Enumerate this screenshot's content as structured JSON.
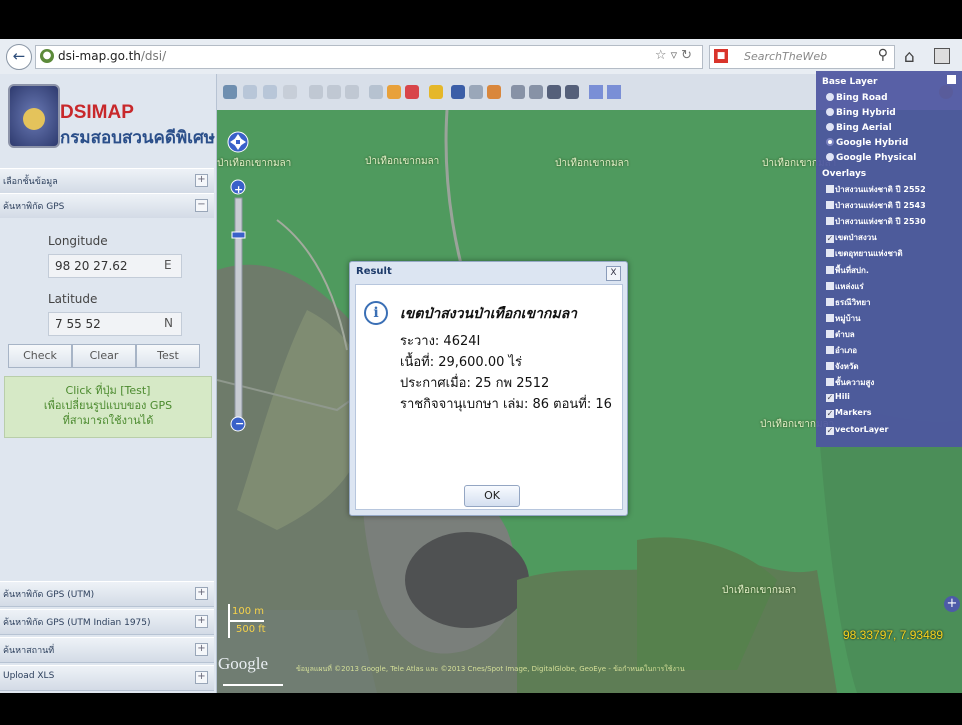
{
  "browser": {
    "url_domain": "dsi-map.go.th",
    "url_path": "/dsi/",
    "search_placeholder": "SearchTheWeb"
  },
  "app": {
    "logo_title": "DSIMAP",
    "logo_subtitle": "กรมสอบสวนคดีพิเศษ"
  },
  "sidebar": {
    "panels_top": [
      {
        "label": "เลือกชั้นข้อมูล",
        "toggle": "+"
      },
      {
        "label": "ค้นหาพิกัด GPS",
        "toggle": "−"
      }
    ],
    "gps": {
      "longitude_label": "Longitude",
      "longitude_value": "98 20 27.62",
      "longitude_unit": "E",
      "latitude_label": "Latitude",
      "latitude_value": "7 55 52",
      "latitude_unit": "N",
      "buttons": [
        "Check",
        "Clear",
        "Test"
      ],
      "hint_lines": [
        "Click ที่ปุ่ม [Test]",
        "เพื่อเปลี่ยนรูปแบบของ GPS",
        "ที่สามารถใช้งานได้"
      ]
    },
    "panels_bottom": [
      {
        "label": "ค้นหาพิกัด GPS (UTM)",
        "toggle": "+"
      },
      {
        "label": "ค้นหาพิกัด GPS (UTM Indian 1975)",
        "toggle": "+"
      },
      {
        "label": "ค้นหาสถานที่",
        "toggle": "+"
      },
      {
        "label": "Upload XLS",
        "toggle": "+"
      }
    ]
  },
  "map": {
    "labels": [
      {
        "text": "ป่าเทือกเขากมลา"
      },
      {
        "text": "ป่าเทือกเขากมลา"
      },
      {
        "text": "ป่าเทือกเขากมลา"
      },
      {
        "text": "ป่าเทือกเขากมลา"
      },
      {
        "text": "ป่าเทือกเขากมลา"
      },
      {
        "text": "ป่าเทือกเขากมลา"
      }
    ],
    "scale_m": "100 m",
    "scale_ft": "500 ft",
    "google": "Google",
    "copyright": "ข้อมูลแผนที่ ©2013 Google, Tele Atlas และ ©2013 Cnes/Spot Image, DigitalGlobe, GeoEye - ข้อกำหนดในการใช้งาน",
    "coordinates": "98.33797, 7.93489"
  },
  "layers": {
    "base_title": "Base Layer",
    "base": [
      {
        "label": "Bing Road",
        "selected": false
      },
      {
        "label": "Bing Hybrid",
        "selected": false
      },
      {
        "label": "Bing Aerial",
        "selected": false
      },
      {
        "label": "Google Hybrid",
        "selected": true
      },
      {
        "label": "Google Physical",
        "selected": false
      }
    ],
    "overlays_title": "Overlays",
    "overlays": [
      {
        "label": "ป่าสงวนแห่งชาติ ปี 2552",
        "checked": false
      },
      {
        "label": "ป่าสงวนแห่งชาติ ปี 2543",
        "checked": false
      },
      {
        "label": "ป่าสงวนแห่งชาติ ปี 2530",
        "checked": false
      },
      {
        "label": "เขตป่าสงวน",
        "checked": true
      },
      {
        "label": "เขตอุทยานแห่งชาติ",
        "checked": false
      },
      {
        "label": "พื้นที่สปก.",
        "checked": false
      },
      {
        "label": "แหล่งแร่",
        "checked": false
      },
      {
        "label": "ธรณีวิทยา",
        "checked": false
      },
      {
        "label": "หมู่บ้าน",
        "checked": false
      },
      {
        "label": "ตำบล",
        "checked": false
      },
      {
        "label": "อำเภอ",
        "checked": false
      },
      {
        "label": "จังหวัด",
        "checked": false
      },
      {
        "label": "ชั้นความสูง",
        "checked": false
      },
      {
        "label": "Hili",
        "checked": true
      },
      {
        "label": "Markers",
        "checked": true
      },
      {
        "label": "vectorLayer",
        "checked": true
      }
    ]
  },
  "dialog": {
    "title": "Result",
    "close": "X",
    "heading": "เขตป่าสงวนป่าเทือกเขากมลา",
    "lines": [
      "ระวาง: 4624I",
      "เนื้อที่: 29,600.00 ไร่",
      "ประกาศเมื่อ: 25 กพ 2512",
      "ราชกิจจานุเบกษา เล่ม: 86 ตอนที่: 16"
    ],
    "ok": "OK"
  },
  "colors": {
    "forest": "#4f9a5e",
    "layer_panel": "#4e56a0",
    "coords": "#f7d21e"
  }
}
